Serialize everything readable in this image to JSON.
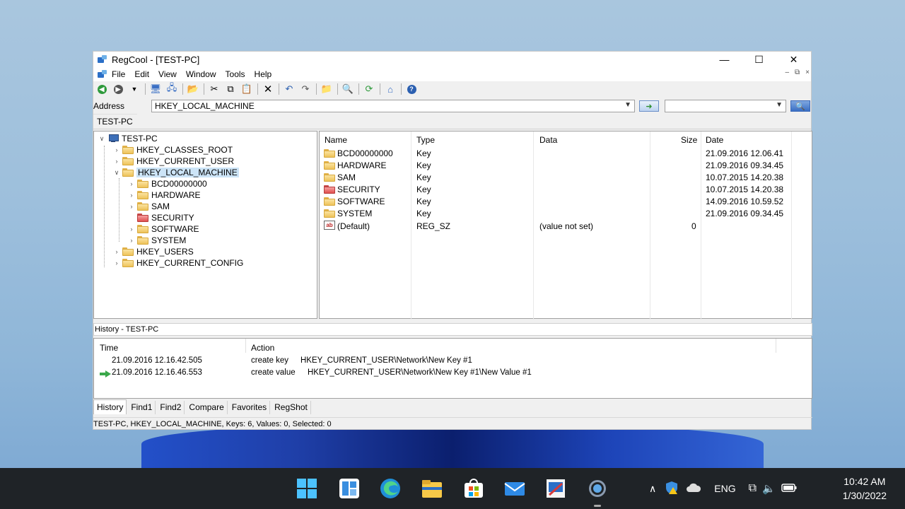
{
  "window": {
    "title": "RegCool - [TEST-PC]",
    "controls": [
      "—",
      "☐",
      "✕"
    ]
  },
  "menu": [
    "File",
    "Edit",
    "View",
    "Window",
    "Tools",
    "Help"
  ],
  "mdi_controls": [
    "–",
    "⧉",
    "×"
  ],
  "address": {
    "label": "Address",
    "value": "HKEY_LOCAL_MACHINE",
    "search_value": ""
  },
  "doc_tab": "TEST-PC",
  "tree": {
    "root": "TEST-PC",
    "hives": {
      "classes_root": "HKEY_CLASSES_ROOT",
      "current_user": "HKEY_CURRENT_USER",
      "local_machine": "HKEY_LOCAL_MACHINE",
      "users": "HKEY_USERS",
      "current_config": "HKEY_CURRENT_CONFIG"
    },
    "children": [
      "BCD00000000",
      "HARDWARE",
      "SAM",
      "SECURITY",
      "SOFTWARE",
      "SYSTEM"
    ]
  },
  "list": {
    "columns": {
      "name": "Name",
      "type": "Type",
      "data": "Data",
      "size": "Size",
      "date": "Date"
    },
    "rows": [
      {
        "name": "BCD00000000",
        "type": "Key",
        "data": "",
        "size": "",
        "date": "21.09.2016 12.06.41"
      },
      {
        "name": "HARDWARE",
        "type": "Key",
        "data": "",
        "size": "",
        "date": "21.09.2016 09.34.45"
      },
      {
        "name": "SAM",
        "type": "Key",
        "data": "",
        "size": "",
        "date": "10.07.2015 14.20.38"
      },
      {
        "name": "SECURITY",
        "type": "Key",
        "data": "",
        "size": "",
        "date": "10.07.2015 14.20.38"
      },
      {
        "name": "SOFTWARE",
        "type": "Key",
        "data": "",
        "size": "",
        "date": "14.09.2016 10.59.52"
      },
      {
        "name": "SYSTEM",
        "type": "Key",
        "data": "",
        "size": "",
        "date": "21.09.2016 09.34.45"
      },
      {
        "name": "(Default)",
        "type": "REG_SZ",
        "data": "(value not set)",
        "size": "0",
        "date": ""
      }
    ]
  },
  "history": {
    "title": "History - TEST-PC",
    "columns": {
      "time": "Time",
      "action": "Action"
    },
    "rows": [
      {
        "time": "21.09.2016 12.16.42.505",
        "action": "create key",
        "path": "HKEY_CURRENT_USER\\Network\\New Key #1"
      },
      {
        "time": "21.09.2016 12.16.46.553",
        "action": "create value",
        "path": "HKEY_CURRENT_USER\\Network\\New Key #1\\New Value #1"
      }
    ]
  },
  "bottom_tabs": [
    "History",
    "Find1",
    "Find2",
    "Compare",
    "Favorites",
    "RegShot"
  ],
  "status": "TEST-PC, HKEY_LOCAL_MACHINE, Keys: 6, Values: 0, Selected: 0",
  "taskbar": {
    "icons": [
      "start-icon",
      "widgets-icon",
      "edge-icon",
      "file-explorer-icon",
      "store-icon",
      "mail-icon",
      "regcool-icon",
      "settings-icon"
    ],
    "tray_lang": "ENG",
    "time": "10:42 AM",
    "date": "1/30/2022"
  }
}
